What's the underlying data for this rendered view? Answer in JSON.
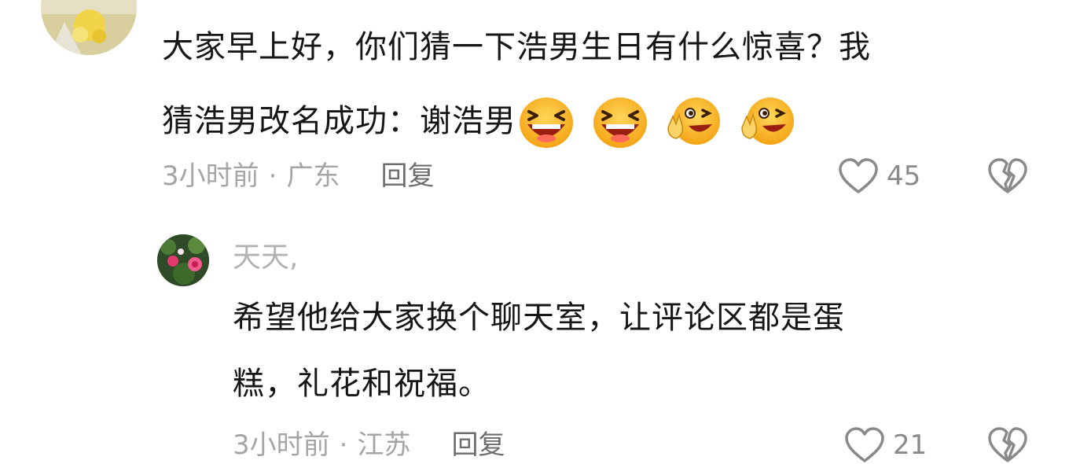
{
  "main_comment": {
    "line1": "大家早上好，你们猜一下浩男生日有什么惊喜？我",
    "line2": "猜浩男改名成功：谢浩男",
    "emojis": [
      "laughing-emoji",
      "laughing-emoji",
      "peace-sign-emoji",
      "peace-sign-emoji"
    ],
    "time": "3小时前",
    "separator": "·",
    "location": "广东",
    "reply_label": "回复",
    "like_count": "45"
  },
  "reply": {
    "author": "天天,",
    "line1": "希望他给大家换个聊天室，让评论区都是蛋",
    "line2": "糕，礼花和祝福。",
    "time": "3小时前",
    "separator": "·",
    "location": "江苏",
    "reply_label": "回复",
    "like_count": "21"
  },
  "colors": {
    "text": "#161616",
    "meta": "#a5a5a5",
    "reply_action": "#6d6d6d",
    "icon_stroke": "#8a8a8a"
  }
}
